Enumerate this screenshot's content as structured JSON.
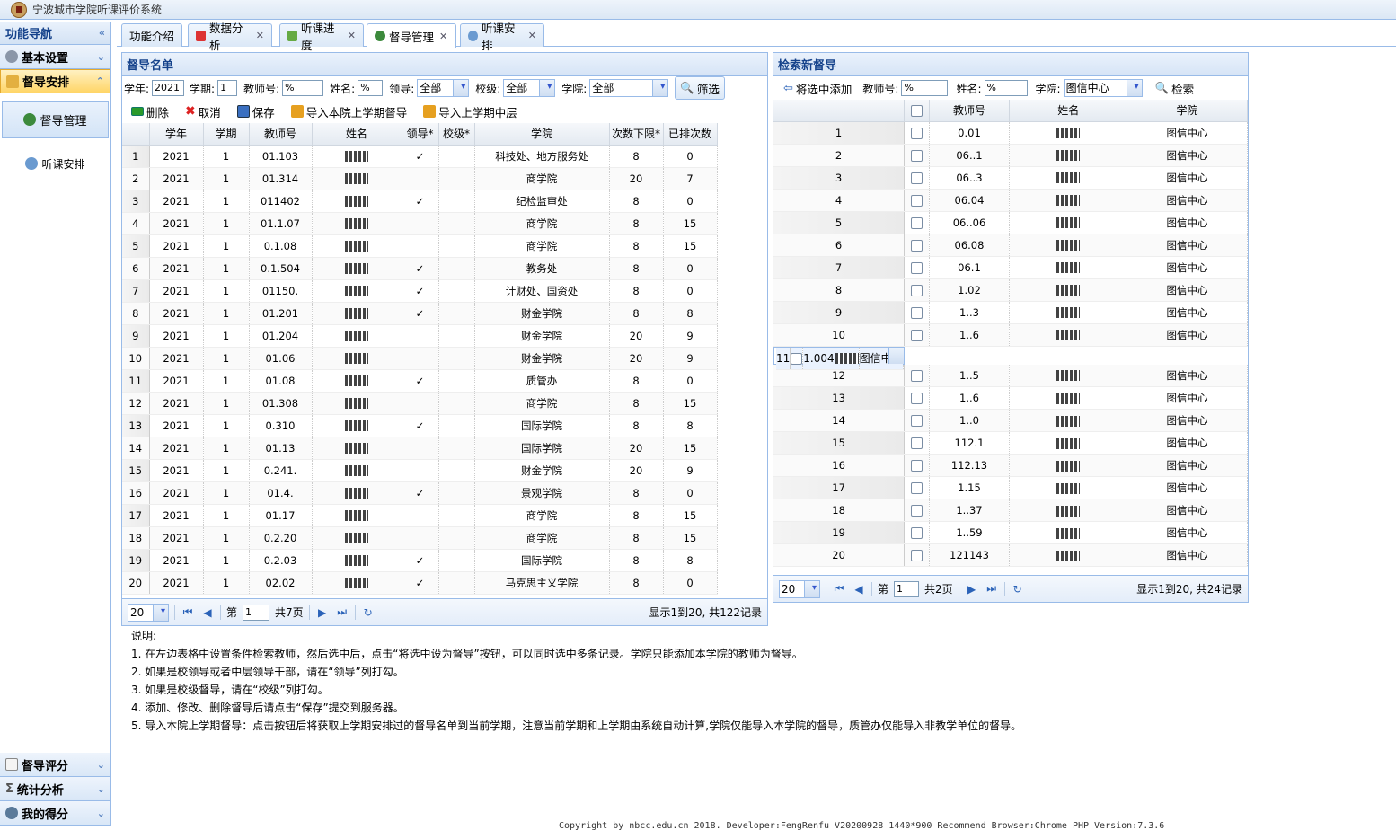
{
  "app": {
    "title": "宁波城市学院听课评价系统"
  },
  "sidebar": {
    "title": "功能导航",
    "sections_top": [
      {
        "label": "基本设置",
        "active": false
      },
      {
        "label": "督导安排",
        "active": true
      }
    ],
    "items": [
      {
        "label": "督导管理"
      },
      {
        "label": "听课安排"
      }
    ],
    "sections_bottom": [
      {
        "label": "督导评分"
      },
      {
        "label": "统计分析"
      },
      {
        "label": "我的得分"
      }
    ]
  },
  "tabs": [
    {
      "label": "功能介绍"
    },
    {
      "label": "数据分析"
    },
    {
      "label": "听课进度"
    },
    {
      "label": "督导管理"
    },
    {
      "label": "听课安排"
    }
  ],
  "left": {
    "title": "督导名单",
    "filters": {
      "year_label": "学年:",
      "year": "2021",
      "term_label": "学期:",
      "term": "1",
      "tid_label": "教师号:",
      "tid": "%",
      "name_label": "姓名:",
      "name": "%",
      "lead_label": "领导:",
      "lead": "全部",
      "school_label": "校级:",
      "school": "全部",
      "college_label": "学院:",
      "college": "全部",
      "filter_btn": "筛选"
    },
    "toolbar": {
      "delete": "删除",
      "cancel": "取消",
      "save": "保存",
      "import_last": "导入本院上学期督导",
      "import_mid": "导入上学期中层"
    },
    "columns": [
      "学年",
      "学期",
      "教师号",
      "姓名",
      "领导*",
      "校级*",
      "学院",
      "次数下限*",
      "已排次数"
    ],
    "rows": [
      [
        "2021",
        "1",
        "01.103",
        "",
        "✓",
        "",
        "科技处、地方服务处",
        "8",
        "0"
      ],
      [
        "2021",
        "1",
        "01.314",
        "",
        "",
        "",
        "商学院",
        "20",
        "7"
      ],
      [
        "2021",
        "1",
        "011402",
        "",
        "✓",
        "",
        "纪检监审处",
        "8",
        "0"
      ],
      [
        "2021",
        "1",
        "01.1.07",
        "",
        "",
        "",
        "商学院",
        "8",
        "15"
      ],
      [
        "2021",
        "1",
        "0.1.08",
        "",
        "",
        "",
        "商学院",
        "8",
        "15"
      ],
      [
        "2021",
        "1",
        "0.1.504",
        "",
        "✓",
        "",
        "教务处",
        "8",
        "0"
      ],
      [
        "2021",
        "1",
        "01150.",
        "",
        "✓",
        "",
        "计财处、国资处",
        "8",
        "0"
      ],
      [
        "2021",
        "1",
        "01.201",
        "",
        "✓",
        "",
        "财金学院",
        "8",
        "8"
      ],
      [
        "2021",
        "1",
        "01.204",
        "",
        "",
        "",
        "财金学院",
        "20",
        "9"
      ],
      [
        "2021",
        "1",
        "01.06",
        "",
        "",
        "",
        "财金学院",
        "20",
        "9"
      ],
      [
        "2021",
        "1",
        "01.08",
        "",
        "✓",
        "",
        "质管办",
        "8",
        "0"
      ],
      [
        "2021",
        "1",
        "01.308",
        "",
        "",
        "",
        "商学院",
        "8",
        "15"
      ],
      [
        "2021",
        "1",
        "0.310",
        "",
        "✓",
        "",
        "国际学院",
        "8",
        "8"
      ],
      [
        "2021",
        "1",
        "01.13",
        "",
        "",
        "",
        "国际学院",
        "20",
        "15"
      ],
      [
        "2021",
        "1",
        "0.241.",
        "",
        "",
        "",
        "财金学院",
        "20",
        "9"
      ],
      [
        "2021",
        "1",
        "01.4.",
        "",
        "✓",
        "",
        "景观学院",
        "8",
        "0"
      ],
      [
        "2021",
        "1",
        "01.17",
        "",
        "",
        "",
        "商学院",
        "8",
        "15"
      ],
      [
        "2021",
        "1",
        "0.2.20",
        "",
        "",
        "",
        "商学院",
        "8",
        "15"
      ],
      [
        "2021",
        "1",
        "0.2.03",
        "",
        "✓",
        "",
        "国际学院",
        "8",
        "8"
      ],
      [
        "2021",
        "1",
        "02.02",
        "",
        "✓",
        "",
        "马克思主义学院",
        "8",
        "0"
      ]
    ],
    "pager": {
      "size": "20",
      "page_prefix": "第",
      "page": "1",
      "pages": "共7页",
      "info": "显示1到20, 共122记录"
    }
  },
  "right": {
    "title": "检索新督导",
    "filters": {
      "add_btn": "将选中添加",
      "tid_label": "教师号:",
      "tid": "%",
      "name_label": "姓名:",
      "name": "%",
      "college_label": "学院:",
      "college": "图信中心",
      "search_btn": "检索"
    },
    "columns": [
      "教师号",
      "姓名",
      "学院"
    ],
    "rows": [
      [
        "0.01",
        "",
        "图信中心"
      ],
      [
        "06..1",
        "",
        "图信中心"
      ],
      [
        "06..3",
        "",
        "图信中心"
      ],
      [
        "06.04",
        "",
        "图信中心"
      ],
      [
        "06..06",
        "",
        "图信中心"
      ],
      [
        "06.08",
        "",
        "图信中心"
      ],
      [
        "06.1",
        "",
        "图信中心"
      ],
      [
        "1.02",
        "",
        "图信中心"
      ],
      [
        "1..3",
        "",
        "图信中心"
      ],
      [
        "1..6",
        "",
        "图信中心"
      ],
      [
        "1.004",
        "",
        "图信中心"
      ],
      [
        "1..5",
        "",
        "图信中心"
      ],
      [
        "1..6",
        "",
        "图信中心"
      ],
      [
        "1..0",
        "",
        "图信中心"
      ],
      [
        "112.1",
        "",
        "图信中心"
      ],
      [
        "112.13",
        "",
        "图信中心"
      ],
      [
        "1.15",
        "",
        "图信中心"
      ],
      [
        "1..37",
        "",
        "图信中心"
      ],
      [
        "1..59",
        "",
        "图信中心"
      ],
      [
        "121143",
        "",
        "图信中心"
      ]
    ],
    "pager": {
      "size": "20",
      "page_prefix": "第",
      "page": "1",
      "pages": "共2页",
      "info": "显示1到20, 共24记录"
    }
  },
  "help": {
    "title": "说明:",
    "lines": [
      "1. 在左边表格中设置条件检索教师，然后选中后，点击“将选中设为督导”按钮，可以同时选中多条记录。学院只能添加本学院的教师为督导。",
      "2. 如果是校领导或者中层领导干部，请在“领导”列打勾。",
      "3. 如果是校级督导，请在“校级”列打勾。",
      "4. 添加、修改、删除督导后请点击“保存”提交到服务器。",
      "5. 导入本院上学期督导：点击按钮后将获取上学期安排过的督导名单到当前学期，注意当前学期和上学期由系统自动计算,学院仅能导入本学院的督导，质管办仅能导入非教学单位的督导。"
    ]
  },
  "footer": "Copyright by nbcc.edu.cn 2018. Developer:FengRenfu V20200928 1440*900 Recommend Browser:Chrome PHP Version:7.3.6"
}
